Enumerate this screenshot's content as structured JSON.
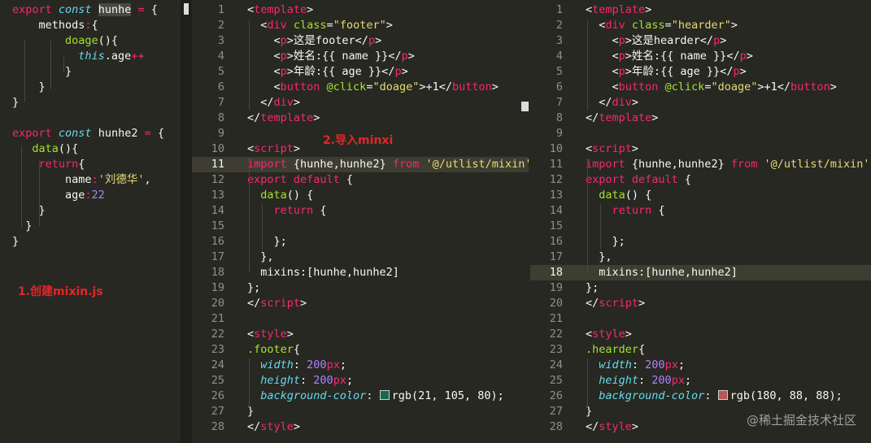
{
  "left_pane": {
    "lines": [
      [
        [
          "k",
          "export "
        ],
        [
          "kt",
          "const "
        ],
        [
          "sel",
          "hunhe"
        ],
        [
          "p",
          " "
        ],
        [
          "k",
          "= "
        ],
        [
          "p",
          "{"
        ]
      ],
      [
        [
          "p",
          "    methods"
        ],
        [
          "k",
          ":"
        ],
        [
          "p",
          "{"
        ]
      ],
      [
        [
          "f",
          "        doage"
        ],
        [
          "p",
          "(){"
        ]
      ],
      [
        [
          "kt",
          "          this"
        ],
        [
          "p",
          ".age"
        ],
        [
          "k",
          "++"
        ]
      ],
      [
        [
          "p",
          "        }"
        ]
      ],
      [
        [
          "p",
          "    }"
        ]
      ],
      [
        [
          "p",
          "}"
        ]
      ],
      [
        [
          "p",
          ""
        ]
      ],
      [
        [
          "k",
          "export "
        ],
        [
          "kt",
          "const "
        ],
        [
          "p",
          "hunhe2 "
        ],
        [
          "k",
          "= "
        ],
        [
          "p",
          "{"
        ]
      ],
      [
        [
          "f",
          "   data"
        ],
        [
          "p",
          "(){"
        ]
      ],
      [
        [
          "k",
          "    return"
        ],
        [
          "p",
          "{"
        ]
      ],
      [
        [
          "p",
          "        name"
        ],
        [
          "k",
          ":"
        ],
        [
          "s",
          "'刘德华'"
        ],
        [
          "p",
          ","
        ]
      ],
      [
        [
          "p",
          "        age"
        ],
        [
          "k",
          ":"
        ],
        [
          "n",
          "22"
        ]
      ],
      [
        [
          "p",
          "    }"
        ]
      ],
      [
        [
          "p",
          "  }"
        ]
      ],
      [
        [
          "p",
          "}"
        ]
      ]
    ],
    "annotation": "1.创建mixin.js"
  },
  "middle_pane": {
    "annotation": "2.导入minxi",
    "line_numbers": [
      "1",
      "2",
      "3",
      "4",
      "5",
      "6",
      "7",
      "8",
      "9",
      "10",
      "11",
      "12",
      "13",
      "14",
      "15",
      "16",
      "17",
      "18",
      "19",
      "20",
      "21",
      "22",
      "23",
      "24",
      "25",
      "26",
      "27",
      "28"
    ],
    "highlight_line": 11,
    "swatch_color": "#156950",
    "lines": [
      [
        [
          "p",
          "<"
        ],
        [
          "t",
          "template"
        ],
        [
          "p",
          ">"
        ]
      ],
      [
        [
          "p",
          "  <"
        ],
        [
          "t",
          "div "
        ],
        [
          "a",
          "class"
        ],
        [
          "p",
          "="
        ],
        [
          "s",
          "\"footer\""
        ],
        [
          "p",
          ">"
        ]
      ],
      [
        [
          "p",
          "    <"
        ],
        [
          "t",
          "p"
        ],
        [
          "p",
          ">这是footer</"
        ],
        [
          "t",
          "p"
        ],
        [
          "p",
          ">"
        ]
      ],
      [
        [
          "p",
          "    <"
        ],
        [
          "t",
          "p"
        ],
        [
          "p",
          ">姓名:{{ name }}</"
        ],
        [
          "t",
          "p"
        ],
        [
          "p",
          ">"
        ]
      ],
      [
        [
          "p",
          "    <"
        ],
        [
          "t",
          "p"
        ],
        [
          "p",
          ">年龄:{{ age }}</"
        ],
        [
          "t",
          "p"
        ],
        [
          "p",
          ">"
        ]
      ],
      [
        [
          "p",
          "    <"
        ],
        [
          "t",
          "button "
        ],
        [
          "a",
          "@click"
        ],
        [
          "p",
          "="
        ],
        [
          "s",
          "\"doage\""
        ],
        [
          "p",
          ">+1</"
        ],
        [
          "t",
          "button"
        ],
        [
          "p",
          ">"
        ]
      ],
      [
        [
          "p",
          "  </"
        ],
        [
          "t",
          "div"
        ],
        [
          "p",
          ">"
        ]
      ],
      [
        [
          "p",
          "</"
        ],
        [
          "t",
          "template"
        ],
        [
          "p",
          ">"
        ]
      ],
      [
        [
          "p",
          ""
        ]
      ],
      [
        [
          "p",
          "<"
        ],
        [
          "t",
          "script"
        ],
        [
          "p",
          ">"
        ]
      ],
      [
        [
          "k",
          "import "
        ],
        [
          "p",
          "{hunhe,hunhe2} "
        ],
        [
          "k",
          "from "
        ],
        [
          "s",
          "'@/utlist/mixin'"
        ]
      ],
      [
        [
          "k",
          "export default "
        ],
        [
          "p",
          "{"
        ]
      ],
      [
        [
          "f",
          "  data"
        ],
        [
          "p",
          "() {"
        ]
      ],
      [
        [
          "k",
          "    return "
        ],
        [
          "p",
          "{"
        ]
      ],
      [
        [
          "p",
          ""
        ]
      ],
      [
        [
          "p",
          "    };"
        ]
      ],
      [
        [
          "p",
          "  },"
        ]
      ],
      [
        [
          "p",
          "  mixins:[hunhe,hunhe2]"
        ]
      ],
      [
        [
          "p",
          "};"
        ]
      ],
      [
        [
          "p",
          "</"
        ],
        [
          "t",
          "script"
        ],
        [
          "p",
          ">"
        ]
      ],
      [
        [
          "p",
          ""
        ]
      ],
      [
        [
          "p",
          "<"
        ],
        [
          "t",
          "style"
        ],
        [
          "p",
          ">"
        ]
      ],
      [
        [
          "f",
          ".footer"
        ],
        [
          "p",
          "{"
        ]
      ],
      [
        [
          "ai",
          "  width"
        ],
        [
          "p",
          ": "
        ],
        [
          "n",
          "200"
        ],
        [
          "k",
          "px"
        ],
        [
          "p",
          ";"
        ]
      ],
      [
        [
          "ai",
          "  height"
        ],
        [
          "p",
          ": "
        ],
        [
          "n",
          "200"
        ],
        [
          "k",
          "px"
        ],
        [
          "p",
          ";"
        ]
      ],
      [
        [
          "ai",
          "  background-color"
        ],
        [
          "p",
          ": "
        ],
        [
          "SW",
          ""
        ],
        [
          "p",
          "rgb(21, 105, 80);"
        ]
      ],
      [
        [
          "p",
          "}"
        ]
      ],
      [
        [
          "p",
          "</"
        ],
        [
          "t",
          "style"
        ],
        [
          "p",
          ">"
        ]
      ]
    ]
  },
  "right_pane": {
    "line_numbers": [
      "1",
      "2",
      "3",
      "4",
      "5",
      "6",
      "7",
      "8",
      "9",
      "10",
      "11",
      "12",
      "13",
      "14",
      "15",
      "16",
      "17",
      "18",
      "19",
      "20",
      "21",
      "22",
      "23",
      "24",
      "25",
      "26",
      "27",
      "28"
    ],
    "highlight_line": 18,
    "swatch_color": "#b45858",
    "lines": [
      [
        [
          "p",
          "<"
        ],
        [
          "t",
          "template"
        ],
        [
          "p",
          ">"
        ]
      ],
      [
        [
          "p",
          "  <"
        ],
        [
          "t",
          "div "
        ],
        [
          "a",
          "class"
        ],
        [
          "p",
          "="
        ],
        [
          "s",
          "\"hearder\""
        ],
        [
          "p",
          ">"
        ]
      ],
      [
        [
          "p",
          "    <"
        ],
        [
          "t",
          "p"
        ],
        [
          "p",
          ">这是hearder</"
        ],
        [
          "t",
          "p"
        ],
        [
          "p",
          ">"
        ]
      ],
      [
        [
          "p",
          "    <"
        ],
        [
          "t",
          "p"
        ],
        [
          "p",
          ">姓名:{{ name }}</"
        ],
        [
          "t",
          "p"
        ],
        [
          "p",
          ">"
        ]
      ],
      [
        [
          "p",
          "    <"
        ],
        [
          "t",
          "p"
        ],
        [
          "p",
          ">年龄:{{ age }}</"
        ],
        [
          "t",
          "p"
        ],
        [
          "p",
          ">"
        ]
      ],
      [
        [
          "p",
          "    <"
        ],
        [
          "t",
          "button "
        ],
        [
          "a",
          "@click"
        ],
        [
          "p",
          "="
        ],
        [
          "s",
          "\"doage\""
        ],
        [
          "p",
          ">+1</"
        ],
        [
          "t",
          "button"
        ],
        [
          "p",
          ">"
        ]
      ],
      [
        [
          "p",
          "  </"
        ],
        [
          "t",
          "div"
        ],
        [
          "p",
          ">"
        ]
      ],
      [
        [
          "p",
          "</"
        ],
        [
          "t",
          "template"
        ],
        [
          "p",
          ">"
        ]
      ],
      [
        [
          "p",
          ""
        ]
      ],
      [
        [
          "p",
          "<"
        ],
        [
          "t",
          "script"
        ],
        [
          "p",
          ">"
        ]
      ],
      [
        [
          "k",
          "import "
        ],
        [
          "p",
          "{hunhe,hunhe2} "
        ],
        [
          "k",
          "from "
        ],
        [
          "s",
          "'@/utlist/mixin'"
        ]
      ],
      [
        [
          "k",
          "export default "
        ],
        [
          "p",
          "{"
        ]
      ],
      [
        [
          "f",
          "  data"
        ],
        [
          "p",
          "() {"
        ]
      ],
      [
        [
          "k",
          "    return "
        ],
        [
          "p",
          "{"
        ]
      ],
      [
        [
          "p",
          ""
        ]
      ],
      [
        [
          "p",
          "    };"
        ]
      ],
      [
        [
          "p",
          "  },"
        ]
      ],
      [
        [
          "p",
          "  mixins:[hunhe,hunhe2]"
        ]
      ],
      [
        [
          "p",
          "};"
        ]
      ],
      [
        [
          "p",
          "</"
        ],
        [
          "t",
          "script"
        ],
        [
          "p",
          ">"
        ]
      ],
      [
        [
          "p",
          ""
        ]
      ],
      [
        [
          "p",
          "<"
        ],
        [
          "t",
          "style"
        ],
        [
          "p",
          ">"
        ]
      ],
      [
        [
          "f",
          ".hearder"
        ],
        [
          "p",
          "{"
        ]
      ],
      [
        [
          "ai",
          "  width"
        ],
        [
          "p",
          ": "
        ],
        [
          "n",
          "200"
        ],
        [
          "k",
          "px"
        ],
        [
          "p",
          ";"
        ]
      ],
      [
        [
          "ai",
          "  height"
        ],
        [
          "p",
          ": "
        ],
        [
          "n",
          "200"
        ],
        [
          "k",
          "px"
        ],
        [
          "p",
          ";"
        ]
      ],
      [
        [
          "ai",
          "  background-color"
        ],
        [
          "p",
          ": "
        ],
        [
          "SW",
          ""
        ],
        [
          "p",
          "rgb(180, 88, 88);"
        ]
      ],
      [
        [
          "p",
          "}"
        ]
      ],
      [
        [
          "p",
          "</"
        ],
        [
          "t",
          "style"
        ],
        [
          "p",
          ">"
        ]
      ]
    ]
  },
  "watermark": "@稀土掘金技术社区"
}
